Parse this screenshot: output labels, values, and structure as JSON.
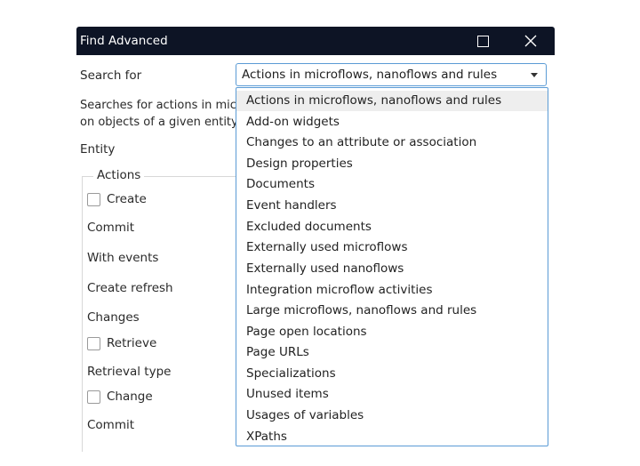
{
  "window": {
    "title": "Find Advanced"
  },
  "search": {
    "label": "Search for",
    "selected": "Actions in microflows, nanoflows and rules",
    "description_line1": "Searches for actions in micr",
    "description_line2": "on objects of a given entity",
    "entity_label": "Entity"
  },
  "actions_group": {
    "legend": "Actions",
    "create": "Create",
    "commit_1": "Commit",
    "with_events": "With events",
    "create_refresh": "Create refresh",
    "changes": "Changes",
    "retrieve": "Retrieve",
    "retrieval_type": "Retrieval type",
    "change": "Change",
    "commit_2": "Commit"
  },
  "dropdown": {
    "options": [
      "Actions in microflows, nanoflows and rules",
      "Add-on widgets",
      "Changes to an attribute or association",
      "Design properties",
      "Documents",
      "Event handlers",
      "Excluded documents",
      "Externally used microflows",
      "Externally used nanoflows",
      "Integration microflow activities",
      "Large microflows, nanoflows and rules",
      "Page open locations",
      "Page URLs",
      "Specializations",
      "Unused items",
      "Usages of variables",
      "XPaths"
    ]
  },
  "colors": {
    "titlebar": "#0d1425",
    "focus_border": "#5b9bd5",
    "selected_option": "#eeeeee"
  },
  "icons": {
    "maximize": "maximize-icon",
    "close": "close-icon",
    "dropdown": "chevron-down-icon"
  }
}
